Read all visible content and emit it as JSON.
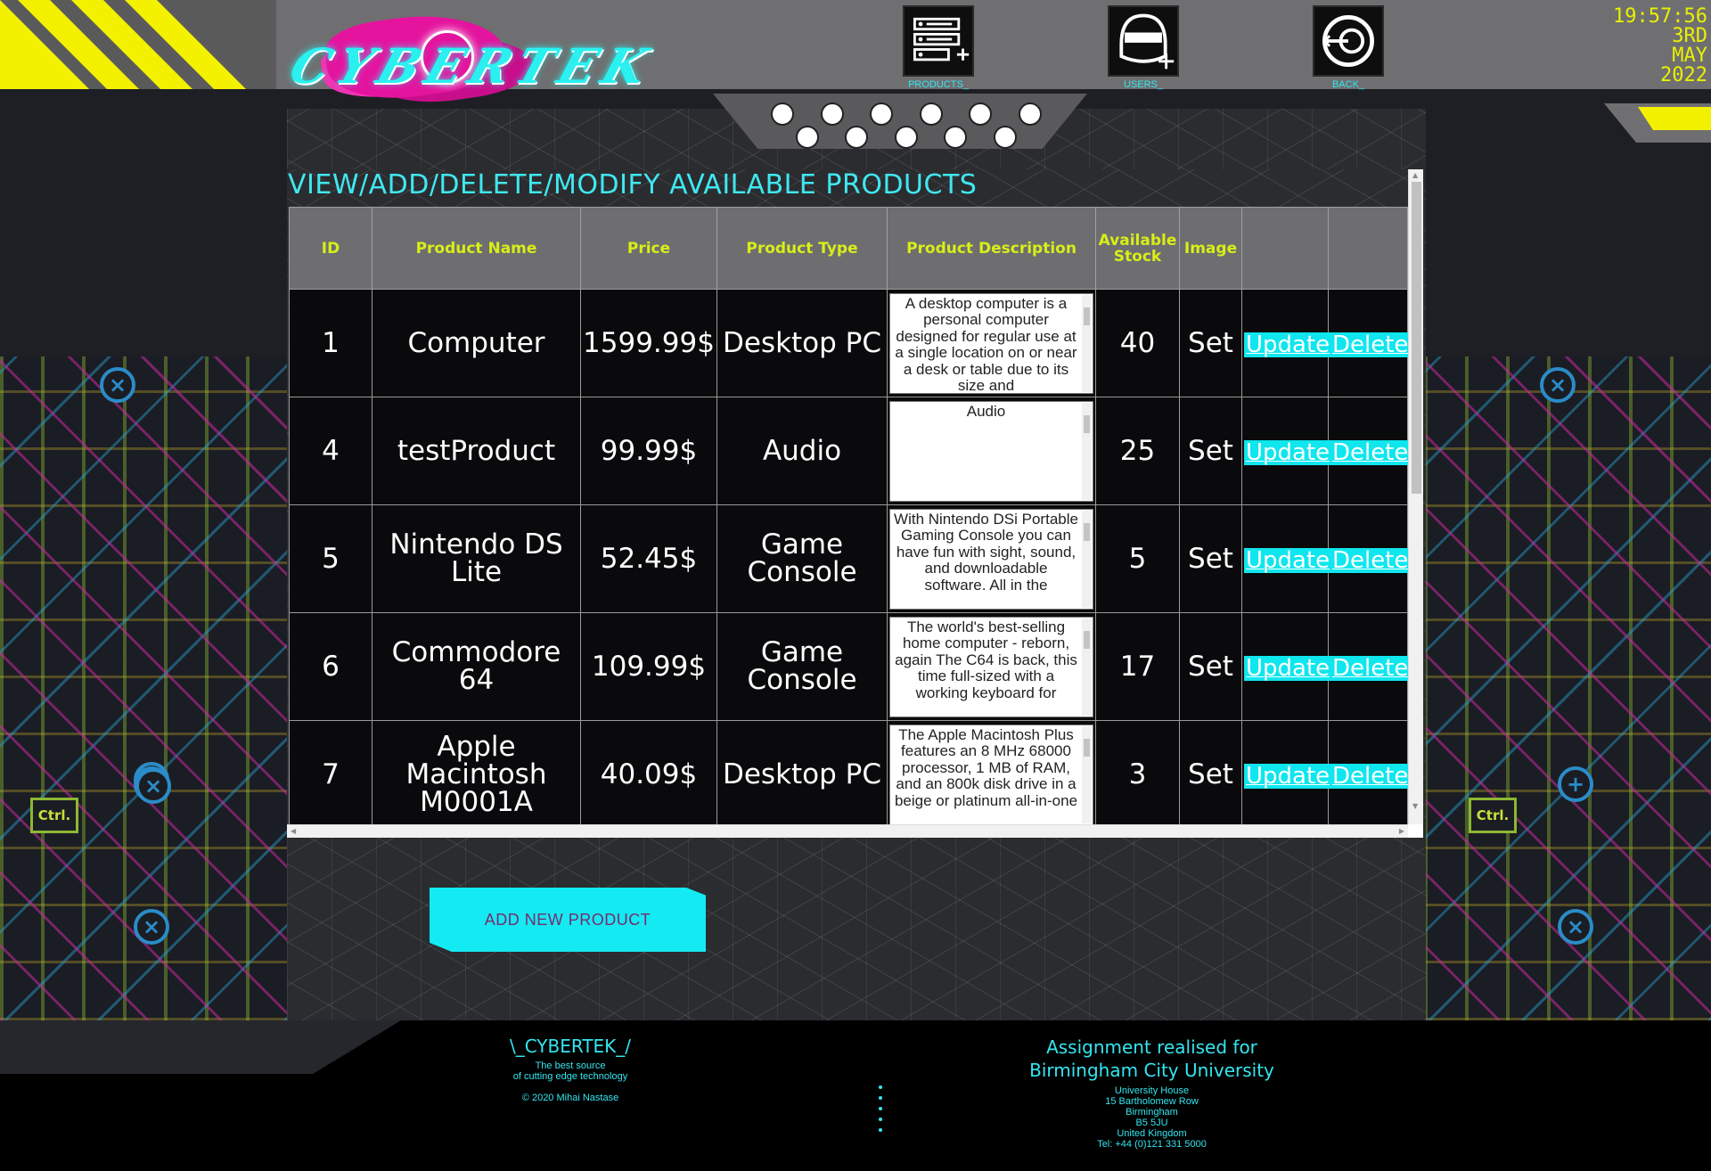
{
  "header": {
    "logo_text": "CYBERTEK",
    "nav": [
      {
        "label": "PRODUCTS_",
        "icon": "product-list-add-icon"
      },
      {
        "label": "USERS_",
        "icon": "user-add-icon"
      },
      {
        "label": "BACK_",
        "icon": "back-icon"
      }
    ],
    "clock": {
      "time": "19:57:56",
      "day": "3RD",
      "month": "MAY",
      "year": "2022"
    }
  },
  "main": {
    "title": "VIEW/ADD/DELETE/MODIFY AVAILABLE PRODUCTS",
    "columns": [
      "ID",
      "Product Name",
      "Price",
      "Product Type",
      "Product Description",
      "Available Stock",
      "Image",
      "",
      ""
    ],
    "rows": [
      {
        "id": "1",
        "name": "Computer",
        "price": "1599.99$",
        "type": "Desktop PC",
        "description": "A desktop computer is a personal computer designed for regular use at a single location on or near a desk or table due to its size and",
        "stock": "40",
        "image": "Set",
        "update": "Update",
        "delete": "Delete"
      },
      {
        "id": "4",
        "name": "testProduct",
        "price": "99.99$",
        "type": "Audio",
        "description": "Audio",
        "stock": "25",
        "image": "Set",
        "update": "Update",
        "delete": "Delete"
      },
      {
        "id": "5",
        "name": "Nintendo DS Lite",
        "price": "52.45$",
        "type": "Game Console",
        "description": "With Nintendo DSi Portable Gaming Console you can have fun with sight, sound, and downloadable software. All in the",
        "stock": "5",
        "image": "Set",
        "update": "Update",
        "delete": "Delete"
      },
      {
        "id": "6",
        "name": "Commodore 64",
        "price": "109.99$",
        "type": "Game Console",
        "description": "The world's best-selling home computer - reborn, again The C64 is back, this time full-sized with a working keyboard for",
        "stock": "17",
        "image": "Set",
        "update": "Update",
        "delete": "Delete"
      },
      {
        "id": "7",
        "name": "Apple Macintosh M0001A",
        "price": "40.09$",
        "type": "Desktop PC",
        "description": "The Apple Macintosh Plus features an 8 MHz 68000 processor, 1 MB of RAM, and an 800k disk drive in a beige or platinum all-in-one",
        "stock": "3",
        "image": "Set",
        "update": "Update",
        "delete": "Delete"
      }
    ],
    "add_button": "ADD NEW PRODUCT"
  },
  "background": {
    "ctrl_key": "Ctrl."
  },
  "footer": {
    "brand": "\\_CYBERTEK_/",
    "tagline_1": "The best source",
    "tagline_2": "of cutting edge technology",
    "copyright": "© 2020 Mihai Nastase",
    "assignment_1": "Assignment realised for",
    "assignment_2": "Birmingham City University",
    "address": [
      "University House",
      "15 Bartholomew Row",
      "Birmingham",
      "B5 5JU",
      "United Kingdom",
      "Tel: +44 (0)121 331 5000"
    ]
  },
  "colors": {
    "accent_cyan": "#13eaf2",
    "accent_yellow": "#f3f100",
    "header_text_yellow": "#d8ee18",
    "logo_pink": "#e4149e"
  }
}
